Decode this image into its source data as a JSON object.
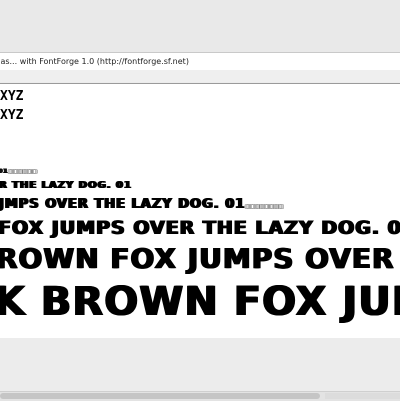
{
  "window": {
    "info_text": "ijas... with FontForge 1.0 (http://fontforge.sf.net)"
  },
  "preview": {
    "lines": [
      "XYZ",
      "XYZ",
      "01",
      "R THE LAZY DOG. 01",
      "JMPS OVER THE LAZY DOG. 01",
      "FOX JUMPS OVER THE LAZY DOG. 01",
      "ROWN FOX JUMPS OVER THE LAZY DO",
      "K BROWN FOX JUMPS O"
    ],
    "small_tail": "□□□□□□",
    "line5_tail": "□□□□□□□□",
    "line6_tail": "□□□□□□□□□□"
  },
  "scrollbar": {
    "visible": true
  }
}
